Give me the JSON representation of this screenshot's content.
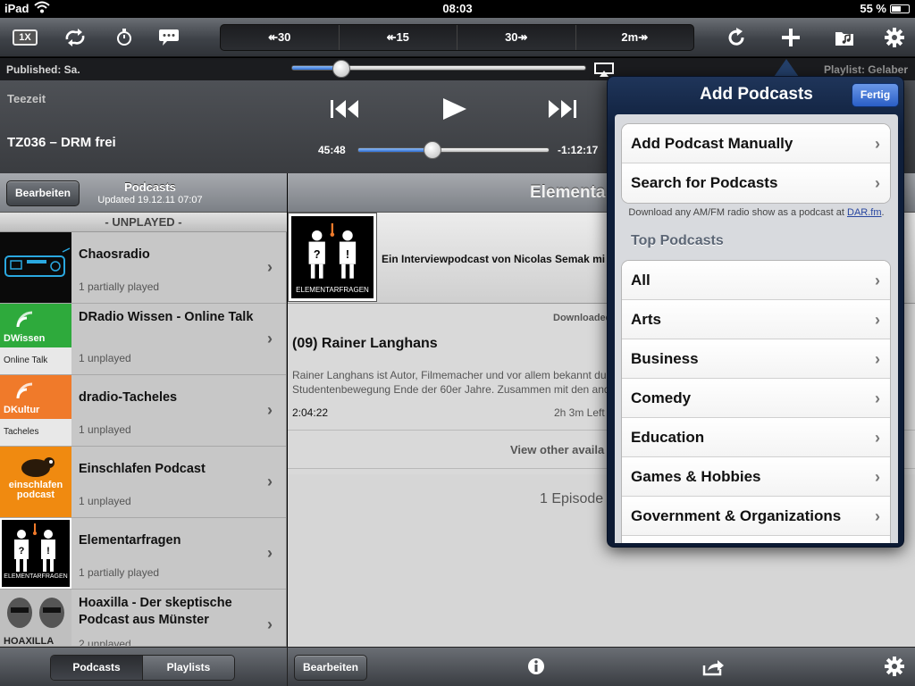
{
  "status_bar": {
    "device": "iPad",
    "time": "08:03",
    "battery": "55 %"
  },
  "toolbar": {
    "speed_label": "1X",
    "seek_buttons": [
      "↞30",
      "↞15",
      "30↠",
      "2m↠"
    ]
  },
  "info_row": {
    "published": "Published: Sa.",
    "playlist": "Playlist: Gelaber",
    "position_fraction": 0.17
  },
  "player": {
    "channel": "Teezeit",
    "episode_title": "TZ036 – DRM frei",
    "elapsed": "45:48",
    "remaining": "-1:12:17",
    "progress_fraction": 0.39
  },
  "left_panel": {
    "edit_label": "Bearbeiten",
    "title": "Podcasts",
    "subtitle": "Updated 19.12.11 07:07",
    "section": "- UNPLAYED -",
    "podcasts": [
      {
        "title": "Chaosradio",
        "status": "1 partially played",
        "art": "chaosradio"
      },
      {
        "title": "DRadio Wissen - Online Talk",
        "status": "1 unplayed",
        "art": "dwissen",
        "art_text": "DWissen",
        "art_sub": "Online Talk"
      },
      {
        "title": "dradio-Tacheles",
        "status": "1 unplayed",
        "art": "dkultur",
        "art_text": "DKultur",
        "art_sub": "Tacheles"
      },
      {
        "title": "Einschlafen Podcast",
        "status": "1 unplayed",
        "art": "einschlafen",
        "art_text": "einschlafen podcast"
      },
      {
        "title": "Elementarfragen",
        "status": "1 partially played",
        "art": "elementarfragen",
        "art_text": "ELEMENTARFRAGEN"
      },
      {
        "title": "Hoaxilla - Der skeptische Podcast aus Münster",
        "status": "2 unplayed",
        "art": "hoaxilla",
        "art_text": "HOAXILLA"
      }
    ]
  },
  "detail": {
    "title": "Elementa",
    "description": "Ein Interviewpodcast von Nicolas Semak mi",
    "art_text": "ELEMENTARFRAGEN",
    "downloaded": "Downloaded",
    "episode_title": "(09) Rainer Langhans",
    "episode_desc_1": "Rainer Langhans ist Autor, Filmemacher und vor allem bekannt du",
    "episode_desc_2": "Studentenbewegung Ende der 60er Jahre. Zusammen mit den and",
    "duration": "2:04:22",
    "time_left": "2h 3m Left",
    "view_other": "View other availa",
    "episode_count": "1 Episode"
  },
  "bottom_bar": {
    "segments": [
      "Podcasts",
      "Playlists"
    ],
    "selected_segment": "Podcasts",
    "edit_label": "Bearbeiten"
  },
  "popover": {
    "title": "Add Podcasts",
    "done_label": "Fertig",
    "actions": [
      "Add Podcast Manually",
      "Search for Podcasts"
    ],
    "note": "Download any AM/FM radio show as a podcast at",
    "note_link": "DAR.fm",
    "note_end": ".",
    "section_header": "Top Podcasts",
    "categories": [
      "All",
      "Arts",
      "Business",
      "Comedy",
      "Education",
      "Games & Hobbies",
      "Government & Organizations"
    ]
  },
  "colors": {
    "accent_blue": "#2f6fd6",
    "popover_navy": "#0f1f3b",
    "dwissen_green": "#2eaa3c",
    "dkultur_orange": "#f07a2a",
    "einschlafen_orange": "#f08a10"
  }
}
